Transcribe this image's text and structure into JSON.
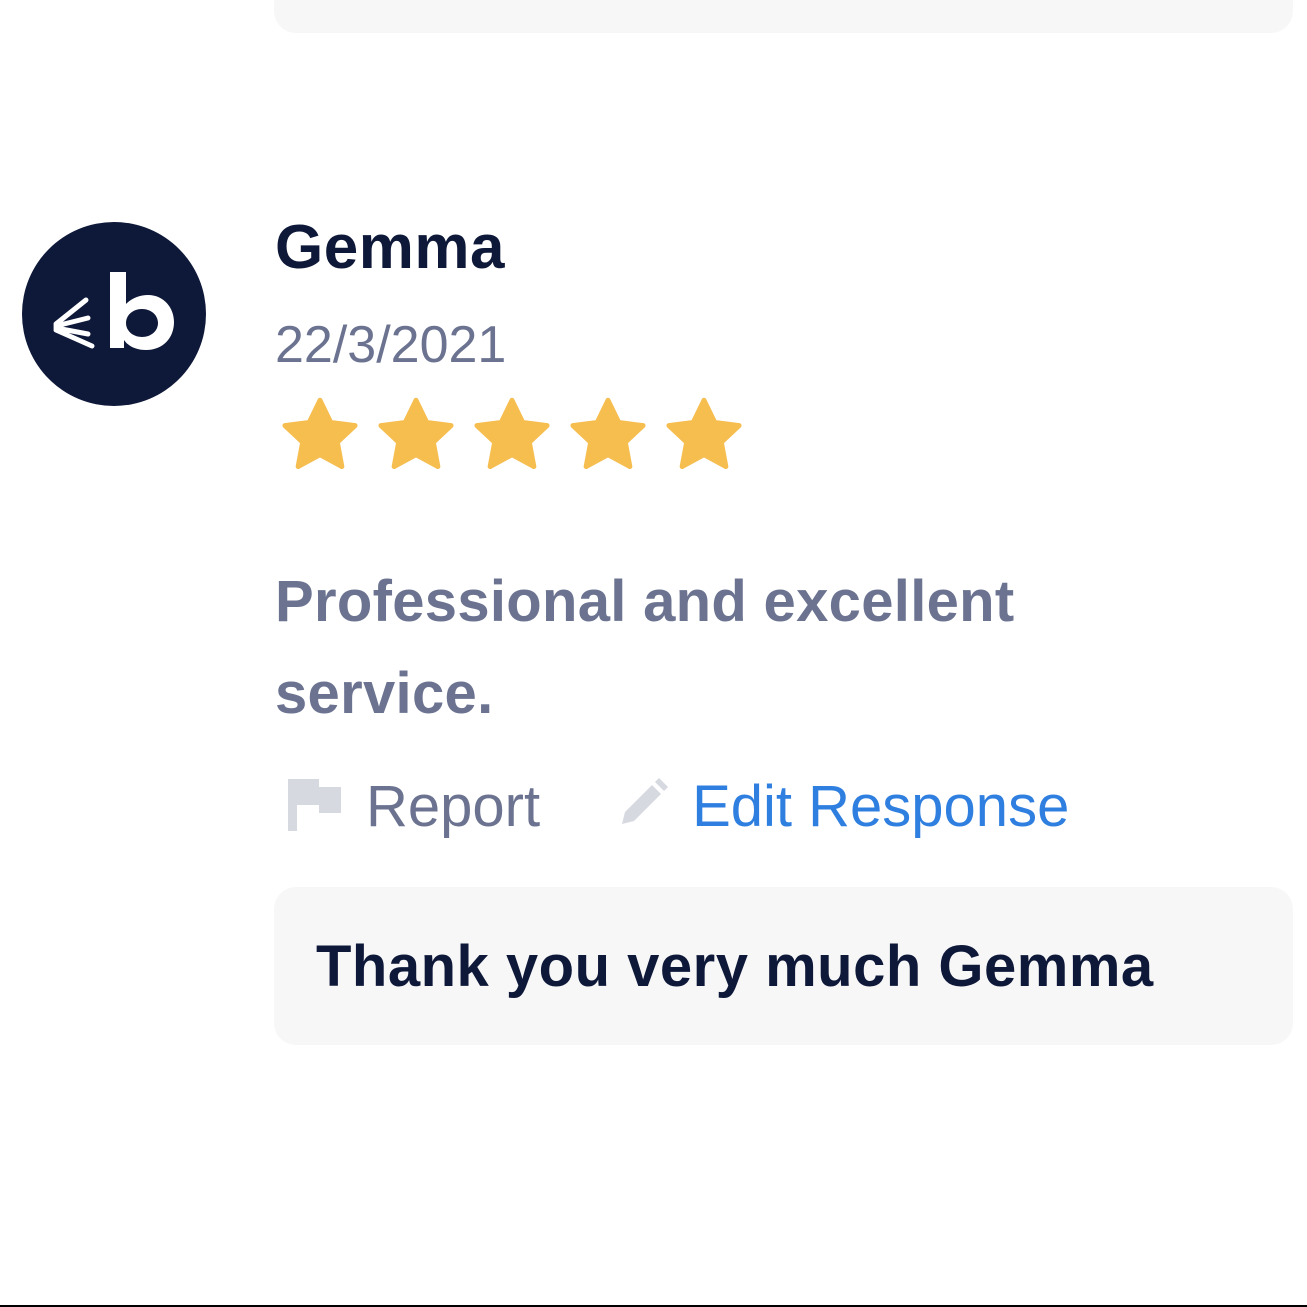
{
  "review": {
    "reviewer_name": "Gemma",
    "date": "22/3/2021",
    "rating": 5,
    "rating_max": 5,
    "text": "Professional and excellent service.",
    "avatar_icon": "booksy-logo-icon"
  },
  "actions": {
    "report_label": "Report",
    "report_icon": "flag-icon",
    "edit_label": "Edit Response",
    "edit_icon": "pencil-icon"
  },
  "response": {
    "text": "Thank you very much Gemma"
  },
  "colors": {
    "avatar_bg": "#0e1838",
    "star": "#f6bd4f",
    "link": "#2f7fe0",
    "muted_text": "#6b7390",
    "dark_text": "#0e1838",
    "card_bg": "#f7f7f8"
  }
}
